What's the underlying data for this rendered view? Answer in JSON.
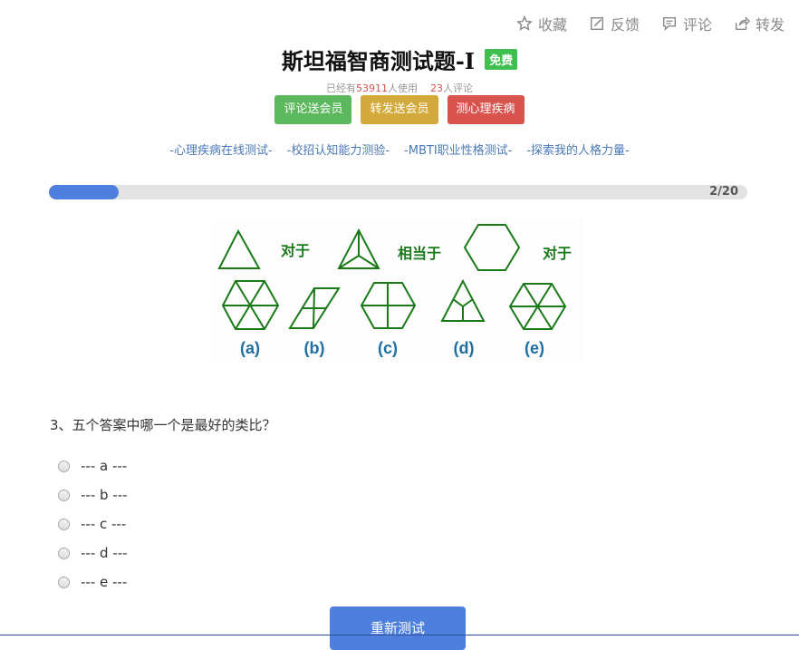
{
  "actions": [
    {
      "label": "收藏",
      "icon": "star-icon"
    },
    {
      "label": "反馈",
      "icon": "edit-icon"
    },
    {
      "label": "评论",
      "icon": "comment-icon"
    },
    {
      "label": "转发",
      "icon": "share-icon"
    }
  ],
  "title": "斯坦福智商测试题-I",
  "badge": "免费",
  "stats": {
    "prefix": "已经有",
    "users": "53911",
    "users_suffix": "人使用",
    "comments": "23",
    "comments_suffix": "人评论"
  },
  "buttons": [
    {
      "label": "评论送会员",
      "color": "#5cb85c"
    },
    {
      "label": "转发送会员",
      "color": "#d4a93b"
    },
    {
      "label": "测心理疾病",
      "color": "#d9534f"
    }
  ],
  "links": [
    "-心理疾病在线测试-",
    "-校招认知能力测验-",
    "-MBTI职业性格测试-",
    "-探索我的人格力量-"
  ],
  "progress": {
    "current": 2,
    "total": 20,
    "label": "2/20",
    "fraction": 0.1
  },
  "figure": {
    "text1": "对于",
    "text2": "相当于",
    "text3": "对于",
    "labels": [
      "(a)",
      "(b)",
      "(c)",
      "(d)",
      "(e)"
    ],
    "stroke_color": "#1a7a1a",
    "label_color": "#1f6fa0"
  },
  "question": "3、五个答案中哪一个是最好的类比？",
  "options": [
    "--- a ---",
    "--- b ---",
    "--- c ---",
    "--- d ---",
    "--- e ---"
  ],
  "retest_label": "重新测试",
  "accent": "#4f7fdc"
}
